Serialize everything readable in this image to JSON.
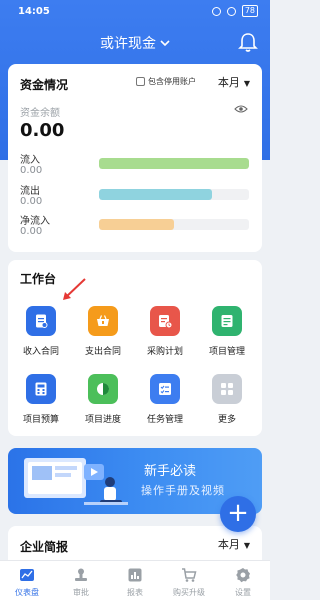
{
  "status": {
    "time": "14:05",
    "battery": "78"
  },
  "header": {
    "title": "或许现金"
  },
  "funds": {
    "title": "资金情况",
    "include_disabled_label": "包含停用账户",
    "period": "本月",
    "balance_label": "资金余额",
    "balance_value": "0.00",
    "rows": [
      {
        "label": "流入",
        "value": "0.00",
        "color": "#a8dc8f",
        "fill": 1.0
      },
      {
        "label": "流出",
        "value": "0.00",
        "color": "#8fd3df",
        "fill": 0.75
      },
      {
        "label": "净流入",
        "value": "0.00",
        "color": "#f7cf95",
        "fill": 0.5
      }
    ]
  },
  "workbench": {
    "title": "工作台",
    "items": [
      {
        "label": "收入合同",
        "icon": "income-contract-icon",
        "color": "#2f6fe6"
      },
      {
        "label": "支出合同",
        "icon": "expense-contract-icon",
        "color": "#f59b1b"
      },
      {
        "label": "采购计划",
        "icon": "purchase-plan-icon",
        "color": "#e8564a"
      },
      {
        "label": "项目管理",
        "icon": "project-management-icon",
        "color": "#2fb36f"
      },
      {
        "label": "项目预算",
        "icon": "project-budget-icon",
        "color": "#2f6fe6"
      },
      {
        "label": "项目进度",
        "icon": "project-progress-icon",
        "color": "#4cbf5a"
      },
      {
        "label": "任务管理",
        "icon": "task-management-icon",
        "color": "#3d7df0"
      },
      {
        "label": "更多",
        "icon": "more-icon",
        "color": "#c9ced6"
      }
    ]
  },
  "banner": {
    "title": "新手必读",
    "subtitle": "操作手册及视频"
  },
  "company": {
    "title": "企业简报",
    "period": "本月"
  },
  "tabs": [
    {
      "label": "仪表盘",
      "icon": "dashboard-icon",
      "active": true
    },
    {
      "label": "审批",
      "icon": "approval-stamp-icon",
      "active": false
    },
    {
      "label": "报表",
      "icon": "report-icon",
      "active": false
    },
    {
      "label": "购买升级",
      "icon": "cart-icon",
      "active": false
    },
    {
      "label": "设置",
      "icon": "gear-icon",
      "active": false
    }
  ]
}
